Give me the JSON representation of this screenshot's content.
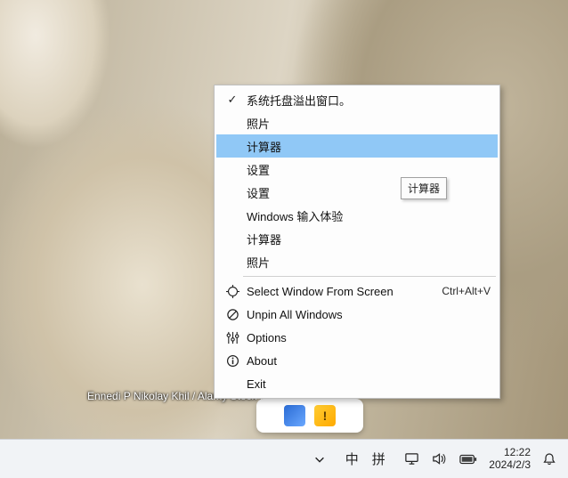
{
  "attribution": "Ennedi P          Nikolay Khil / Alamy Stock Photo)",
  "menu": {
    "items": [
      {
        "label": "系统托盘溢出窗口。",
        "checked": true
      },
      {
        "label": "照片"
      },
      {
        "label": "计算器",
        "highlight": true
      },
      {
        "label": "设置"
      },
      {
        "label": "设置"
      },
      {
        "label": "Windows 输入体验"
      },
      {
        "label": "计算器"
      },
      {
        "label": "照片"
      }
    ],
    "select_window": {
      "label": "Select Window From Screen",
      "shortcut": "Ctrl+Alt+V"
    },
    "unpin": {
      "label": "Unpin All Windows"
    },
    "options": {
      "label": "Options"
    },
    "about": {
      "label": "About"
    },
    "exit": {
      "label": "Exit"
    }
  },
  "tooltip": "计算器",
  "taskbar": {
    "ime_lang": "中",
    "ime_mode": "拼",
    "time": "12:22",
    "date": "2024/2/3"
  }
}
